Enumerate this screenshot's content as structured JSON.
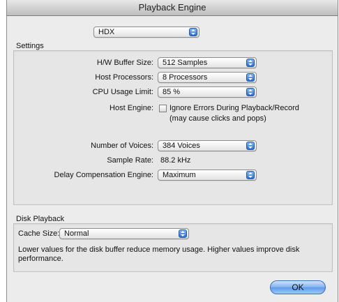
{
  "window": {
    "title": "Playback Engine"
  },
  "engine_select": {
    "value": "HDX"
  },
  "settings": {
    "label": "Settings",
    "hw_buffer_size": {
      "label": "H/W Buffer Size:",
      "value": "512 Samples"
    },
    "host_processors": {
      "label": "Host Processors:",
      "value": "8 Processors"
    },
    "cpu_usage_limit": {
      "label": "CPU Usage Limit:",
      "value": "85 %"
    },
    "host_engine": {
      "label": "Host Engine:",
      "checkbox_label": "Ignore Errors During Playback/Record",
      "note": "(may cause clicks and pops)",
      "checked": false
    },
    "number_of_voices": {
      "label": "Number of Voices:",
      "value": "384 Voices"
    },
    "sample_rate": {
      "label": "Sample Rate:",
      "value": "88.2 kHz"
    },
    "delay_compensation": {
      "label": "Delay Compensation Engine:",
      "value": "Maximum"
    }
  },
  "disk_playback": {
    "label": "Disk Playback",
    "cache_size": {
      "label": "Cache Size:",
      "value": "Normal"
    },
    "description": "Lower values for the disk buffer reduce memory usage.  Higher values improve disk performance."
  },
  "ok_button": {
    "label": "OK"
  },
  "colors": {
    "accent": "#2a6fd6",
    "window_bg": "#ececec"
  }
}
